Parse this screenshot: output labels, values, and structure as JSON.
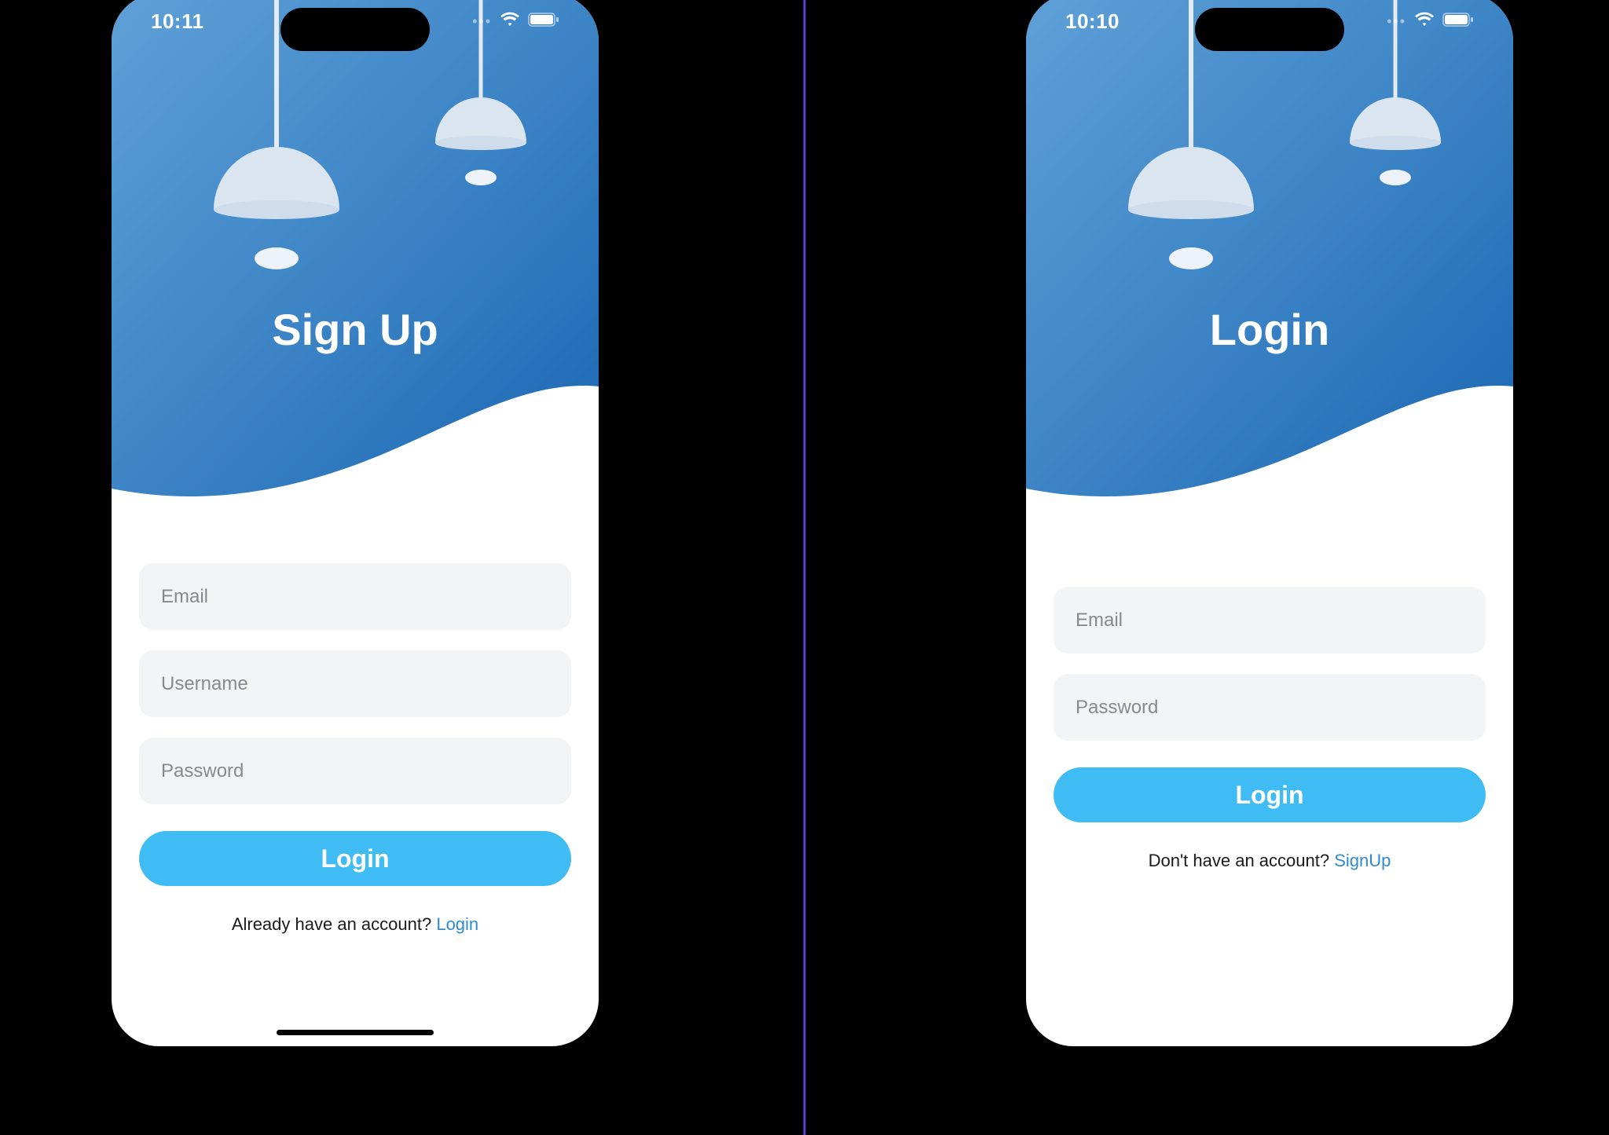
{
  "left": {
    "status_time": "10:11",
    "title": "Sign Up",
    "email_placeholder": "Email",
    "username_placeholder": "Username",
    "password_placeholder": "Password",
    "button_label": "Login",
    "footer_text": "Already have an account? ",
    "footer_link": "Login"
  },
  "right": {
    "status_time": "10:10",
    "title": "Login",
    "email_placeholder": "Email",
    "password_placeholder": "Password",
    "button_label": "Login",
    "footer_text": "Don't have an account? ",
    "footer_link": "SignUp"
  }
}
